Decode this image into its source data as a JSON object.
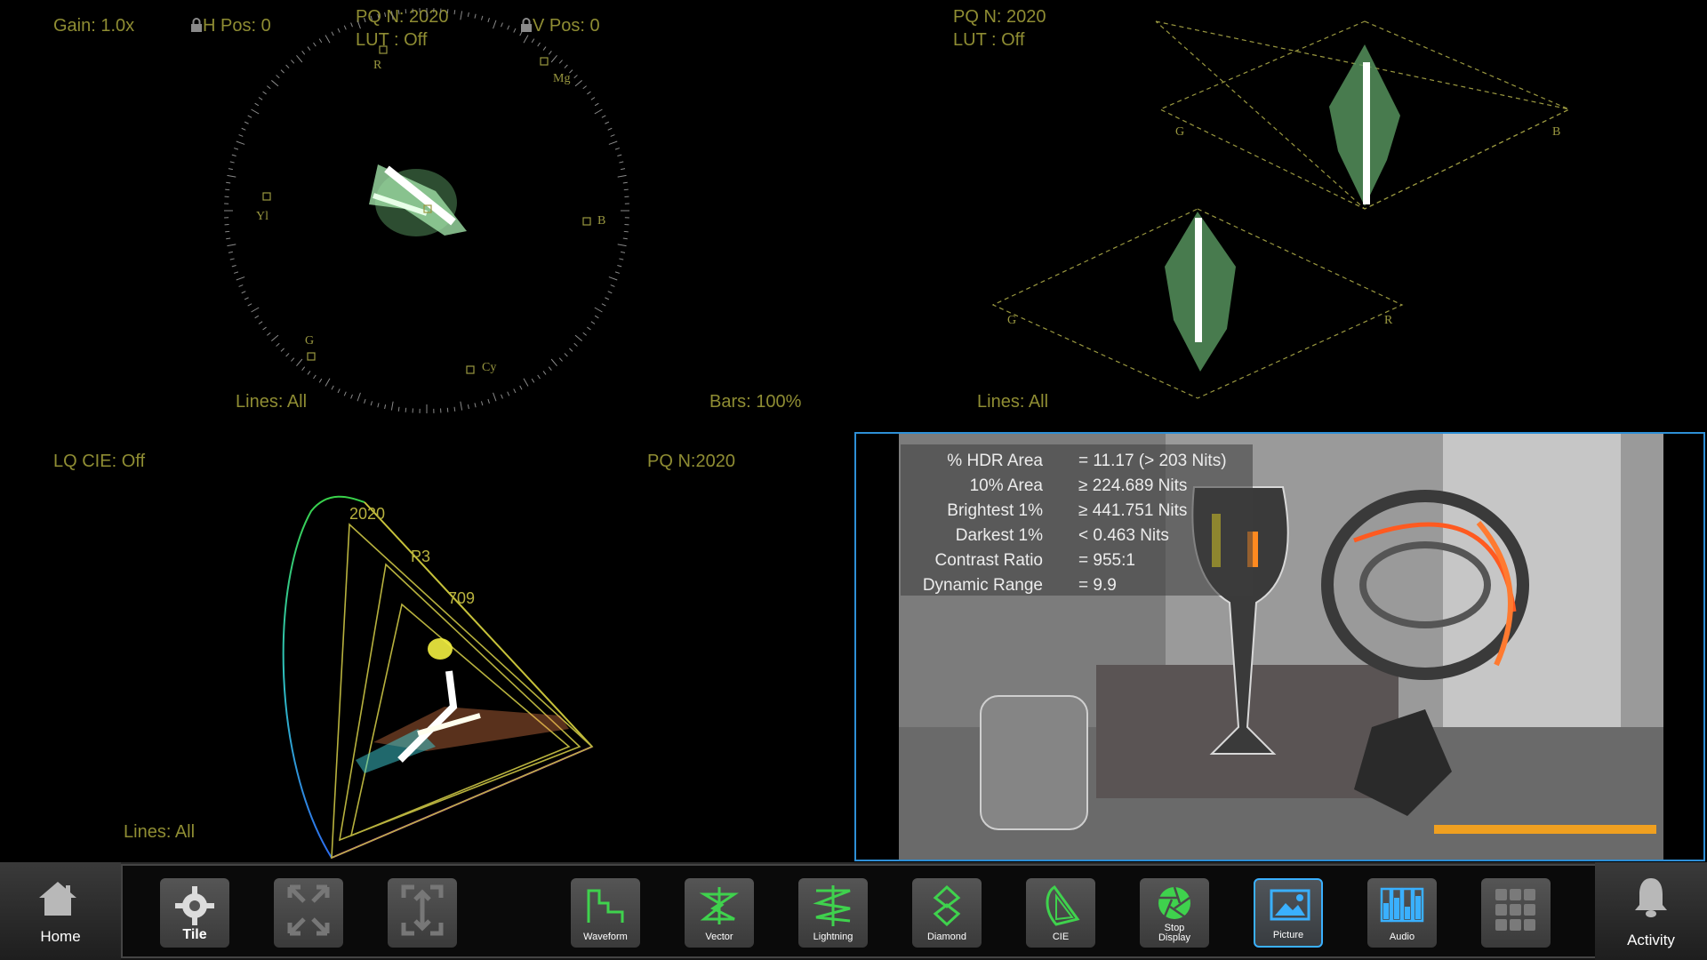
{
  "vector": {
    "gain": "Gain: 1.0x",
    "h_pos": "H Pos: 0",
    "v_pos": "V Pos: 0",
    "pq": "PQ N: 2020",
    "lut": "LUT : Off",
    "lines": "Lines: All",
    "bars": "Bars: 100%",
    "targets": {
      "r": "R",
      "mg": "Mg",
      "b": "B",
      "cy": "Cy",
      "g": "G",
      "yl": "Yl"
    }
  },
  "diamond": {
    "pq": "PQ N: 2020",
    "lut": "LUT : Off",
    "lines": "Lines: All",
    "labels": {
      "g_top": "G",
      "b": "B",
      "g_bottom": "G",
      "r": "R"
    }
  },
  "cie": {
    "lq": "LQ CIE: Off",
    "pq": "PQ N:2020",
    "lines": "Lines: All",
    "gamut_2020": "2020",
    "gamut_p3": "P3",
    "gamut_709": "709"
  },
  "picture": {
    "rows": [
      {
        "key": "% HDR Area",
        "value": "= 11.17 (> 203 Nits)"
      },
      {
        "key": "10% Area",
        "value": "≥ 224.689 Nits"
      },
      {
        "key": "Brightest 1%",
        "value": "≥ 441.751 Nits"
      },
      {
        "key": "Darkest 1%",
        "value": "< 0.463 Nits"
      },
      {
        "key": "Contrast Ratio",
        "value": "= 955:1"
      },
      {
        "key": "Dynamic Range",
        "value": "= 9.9"
      }
    ]
  },
  "toolbar": {
    "home": "Home",
    "tile": "Tile",
    "waveform": "Waveform",
    "vector": "Vector",
    "lightning": "Lightning",
    "diamond": "Diamond",
    "cie": "CIE",
    "stop_display_1": "Stop",
    "stop_display_2": "Display",
    "picture": "Picture",
    "audio": "Audio",
    "activity": "Activity"
  },
  "colors": {
    "accent": "#3ab0ff",
    "label": "#8f8d33",
    "trace": "#7fd88a"
  }
}
